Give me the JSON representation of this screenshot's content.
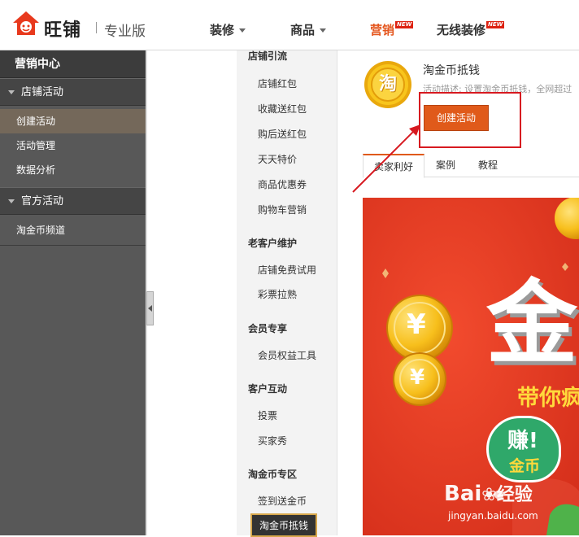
{
  "brand": {
    "logo_text": "旺铺",
    "edition": "专业版"
  },
  "topnav": {
    "items": [
      {
        "label": "装修",
        "dropdown": true
      },
      {
        "label": "商品",
        "dropdown": true
      },
      {
        "label": "营销",
        "badge": "NEW",
        "active": true
      },
      {
        "label": "无线装修",
        "badge": "NEW"
      }
    ]
  },
  "sidebar": {
    "title": "营销中心",
    "groups": [
      {
        "label": "店铺活动",
        "items": [
          "创建活动",
          "活动管理",
          "数据分析"
        ],
        "active_item": "创建活动"
      },
      {
        "label": "官方活动",
        "items": [
          "淘金币频道"
        ]
      }
    ]
  },
  "midnav": {
    "sections": [
      {
        "title": "店铺引流",
        "links": [
          "店铺红包",
          "收藏送红包",
          "购后送红包",
          "天天特价",
          "商品优惠券",
          "购物车营销"
        ]
      },
      {
        "title": "老客户维护",
        "links": [
          "店铺免费试用",
          "彩票拉熟"
        ]
      },
      {
        "title": "会员专享",
        "links": [
          "会员权益工具"
        ]
      },
      {
        "title": "客户互动",
        "links": [
          "投票",
          "买家秀"
        ]
      },
      {
        "title": "淘金币专区",
        "links": [
          "签到送金币",
          "淘金币抵钱"
        ]
      }
    ],
    "active_link": "淘金币抵钱"
  },
  "activity": {
    "icon_char": "淘",
    "title": "淘金币抵钱",
    "description": "活动描述: 设置淘金币抵钱，全网超过",
    "create_button": "创建活动",
    "tabs": [
      "卖家利好",
      "案例",
      "教程"
    ],
    "active_tab": "卖家利好"
  },
  "banner": {
    "big_char": "金",
    "slogan": "带你疯",
    "badge_line1": "赚!",
    "badge_line2": "金币",
    "yen": "¥"
  },
  "watermark": {
    "brand": "Bai",
    "brand_cn": "经验",
    "url": "jingyan.baidu.com"
  },
  "colors": {
    "accent": "#e05a1a",
    "highlight": "#d71920",
    "sidebar_bg": "#585858",
    "banner_bg": "#e43c24"
  }
}
